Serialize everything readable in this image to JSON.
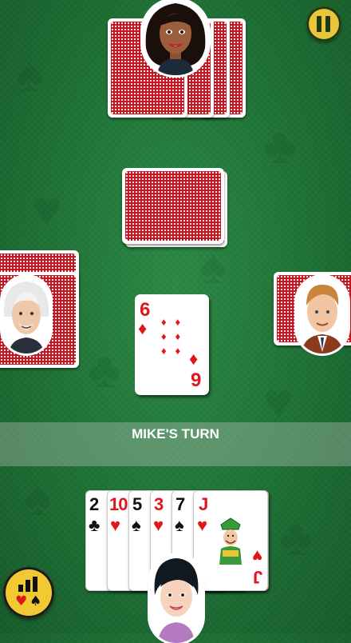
{
  "game": {
    "turn_banner": "MIKE'S TURN"
  },
  "table": {
    "played_card": {
      "top_rank": "6",
      "bottom_rank": "9",
      "suit": "diamonds",
      "suit_glyph": "♦"
    }
  },
  "player_hand": {
    "cards": [
      {
        "rank": "2",
        "suit_glyph": "♣",
        "suit": "clubs"
      },
      {
        "rank": "10",
        "suit_glyph": "♥",
        "suit": "hearts"
      },
      {
        "rank": "5",
        "suit_glyph": "♠",
        "suit": "spades"
      },
      {
        "rank": "3",
        "suit_glyph": "♥",
        "suit": "hearts"
      },
      {
        "rank": "7",
        "suit_glyph": "♠",
        "suit": "spades"
      },
      {
        "rank": "J",
        "suit_glyph": "♥",
        "suit": "hearts"
      }
    ]
  },
  "colors": {
    "table_green": "#1f7136",
    "card_back_red": "#c5141e",
    "suit_red": "#e0161d",
    "button_yellow": "#e9c53c"
  },
  "icons": {
    "pause": "pause-icon",
    "stats": "stats-icon"
  }
}
